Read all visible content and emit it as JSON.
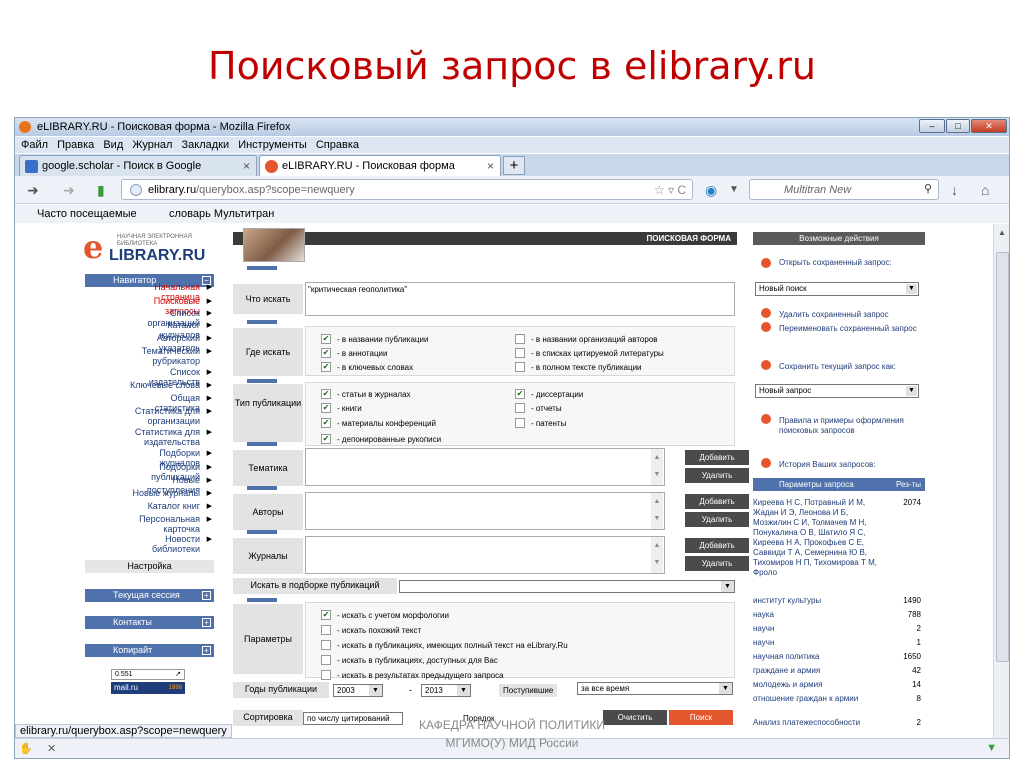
{
  "slide_title": "Поисковый запрос в elibrary.ru",
  "window": {
    "title": "eLIBRARY.RU - Поисковая форма - Mozilla Firefox"
  },
  "menu": [
    "Файл",
    "Правка",
    "Вид",
    "Журнал",
    "Закладки",
    "Инструменты",
    "Справка"
  ],
  "tabs": [
    {
      "label": "google.scholar - Поиск в Google",
      "close": "×"
    },
    {
      "label": "eLIBRARY.RU - Поисковая форма",
      "close": "×"
    }
  ],
  "new_tab": "+",
  "url": {
    "domain": "elibrary.ru",
    "path": "/querybox.asp?scope=newquery"
  },
  "search_placeholder": "Multitran New",
  "bookmarks": [
    "Часто посещаемые",
    "словарь Мультитран"
  ],
  "logo": {
    "subtitle": "НАУЧНАЯ ЭЛЕКТРОННАЯ БИБЛИОТЕКА",
    "text": "LIBRARY.RU"
  },
  "navigator": {
    "header": "Навигатор",
    "items": [
      {
        "label": "Начальная страница",
        "red": true
      },
      {
        "label": "Поисковые запросы",
        "red": true
      },
      {
        "label": "Список организаций"
      },
      {
        "label": "Каталог журналов"
      },
      {
        "label": "Авторский указатель"
      },
      {
        "label": "Тематический рубрикатор"
      },
      {
        "label": "Список издательств"
      },
      {
        "label": "Ключевые слова"
      },
      {
        "label": "Общая статистика"
      },
      {
        "label": "Статистика для организации"
      },
      {
        "label": "Статистика для издательства"
      },
      {
        "label": "Подборки журналов"
      },
      {
        "label": "Подборки публикаций"
      },
      {
        "label": "Новые поступления"
      },
      {
        "label": "Новые журналы"
      },
      {
        "label": "Каталог книг"
      },
      {
        "label": "Персональная карточка"
      },
      {
        "label": "Новости библиотеки"
      }
    ],
    "settings": "Настройка",
    "session": "Текущая сессия",
    "contacts": "Контакты",
    "copyright": "Копирайт",
    "counter1": "0.551",
    "counter2": "mail.ru",
    "counter2_year": "1998"
  },
  "form": {
    "header": "ПОИСКОВАЯ ФОРМА",
    "what_label": "Что искать",
    "what_value": "\"критическая геополитика\"",
    "where_label": "Где искать",
    "where": [
      {
        "label": "- в названии публикации",
        "checked": true
      },
      {
        "label": "- в аннотации",
        "checked": true
      },
      {
        "label": "- в ключевых словах",
        "checked": true
      },
      {
        "label": "- в названии организаций авторов",
        "checked": false
      },
      {
        "label": "- в списках цитируемой литературы",
        "checked": false
      },
      {
        "label": "- в полном тексте публикации",
        "checked": false
      }
    ],
    "type_label": "Тип публикации",
    "types": [
      {
        "label": "- статьи в журналах",
        "checked": true
      },
      {
        "label": "- книги",
        "checked": true
      },
      {
        "label": "- материалы конференций",
        "checked": true
      },
      {
        "label": "- депонированные рукописи",
        "checked": true
      },
      {
        "label": "- диссертации",
        "checked": true
      },
      {
        "label": "- отчеты",
        "checked": false
      },
      {
        "label": "- патенты",
        "checked": false
      }
    ],
    "topic_label": "Тематика",
    "authors_label": "Авторы",
    "journals_label": "Журналы",
    "add": "Добавить",
    "remove": "Удалить",
    "in_collection_label": "Искать в подборке публикаций",
    "params_label": "Параметры",
    "params": [
      {
        "label": "- искать с учетом морфологии",
        "checked": true
      },
      {
        "label": "- искать похожий текст",
        "checked": false
      },
      {
        "label": "- искать в публикациях, имеющих полный текст на eLibrary.Ru",
        "checked": false
      },
      {
        "label": "- искать в публикациях, доступных для Вас",
        "checked": false
      },
      {
        "label": "- искать в результатах предыдущего запроса",
        "checked": false
      }
    ],
    "years_label": "Годы публикации",
    "year_from": "2003",
    "year_dash": "-",
    "year_to": "2013",
    "arrived_label": "Поступившие",
    "arrived_value": "за все время",
    "sort_label": "Сортировка",
    "sort_value": "по числу цитирований",
    "order_label": "Порядок",
    "clear": "Очистить",
    "search": "Поиск"
  },
  "right": {
    "header": "Возможные действия",
    "open_saved": "Открыть сохраненный запрос:",
    "new_search": "Новый поиск",
    "delete_saved": "Удалить сохраненный запрос",
    "rename_saved": "Переименовать сохраненный запрос",
    "save_current": "Сохранить текущий запрос как:",
    "new_query": "Новый запрос",
    "rules": "Правила и примеры оформления поисковых запросов",
    "history": "История Ваших запросов:",
    "params_head": "Параметры запроса",
    "results_head": "Рез-ты",
    "rows": [
      {
        "name": "Киреева Н С, Потравный И М, Жадан И Э, Леонова И Б, Мозжилин С И, Толмачев М Н, Понукалина О В, Шатило Я С, Киреева Н А, Прокофьев С Е, Саввиди Т А, Семернина Ю В, Тихомиров Н П, Тихомирова Т М, Фроло",
        "count": "2074"
      },
      {
        "name": "институт культуры",
        "count": "1490"
      },
      {
        "name": "наука",
        "count": "788"
      },
      {
        "name": "научн",
        "count": "2"
      },
      {
        "name": "научн",
        "count": "1"
      },
      {
        "name": "научная политика",
        "count": "1650"
      },
      {
        "name": "граждане и армия",
        "count": "42"
      },
      {
        "name": "молодежь и армия",
        "count": "14"
      },
      {
        "name": "отношение граждан к армии",
        "count": "8"
      },
      {
        "name": "Анализ платежеспособности",
        "count": "2"
      }
    ]
  },
  "status_url": "elibrary.ru/querybox.asp?scope=newquery",
  "footer_overlay": "КАФЕДРА НАУЧНОЙ ПОЛИТИКИ",
  "footer": "МГИМО(У) МИД России"
}
